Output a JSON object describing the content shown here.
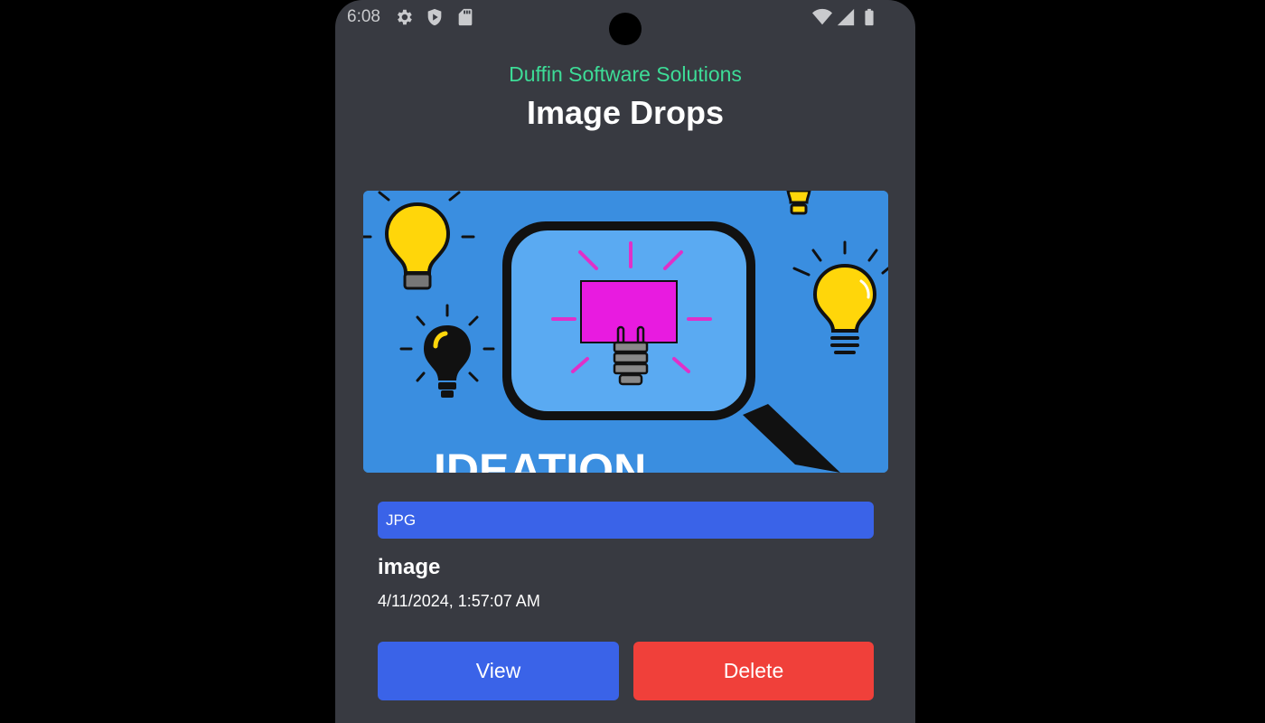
{
  "status_bar": {
    "time": "6:08",
    "left_icons": [
      "gear-icon",
      "shield-play-icon",
      "sd-card-icon"
    ],
    "right_icons": [
      "wifi-icon",
      "signal-icon",
      "battery-icon"
    ]
  },
  "header": {
    "company": "Duffin Software Solutions",
    "title": "Image Drops"
  },
  "image_card": {
    "thumbnail_text": "IDEATION",
    "file_type": "JPG",
    "file_name": "image",
    "date": "4/11/2024, 1:57:07 AM",
    "view_label": "View",
    "delete_label": "Delete"
  },
  "colors": {
    "accent_green": "#3ddc97",
    "primary_blue": "#3a63e8",
    "danger_red": "#f0403a",
    "background": "#383a41"
  }
}
